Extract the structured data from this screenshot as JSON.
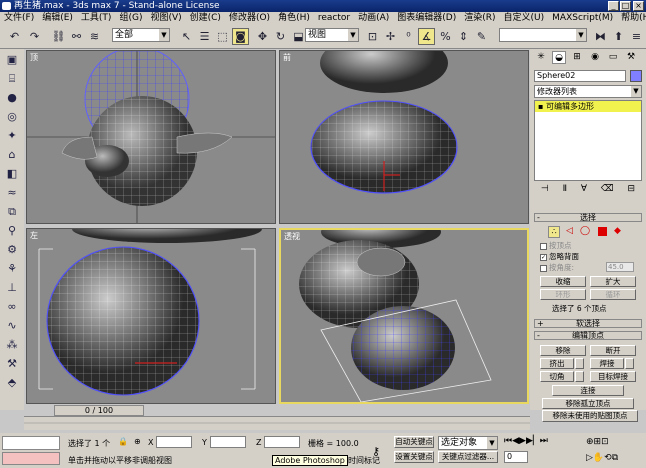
{
  "titlebar": {
    "title": "再生猪.max - 3ds max 7 - Stand-alone License",
    "min": "_",
    "max": "□",
    "close": "×"
  },
  "menu": [
    "文件(F)",
    "编辑(E)",
    "工具(T)",
    "组(G)",
    "视图(V)",
    "创建(C)",
    "修改器(O)",
    "角色(H)",
    "reactor",
    "动画(A)",
    "图表编辑器(D)",
    "渲染(R)",
    "自定义(U)",
    "MAXScript(M)",
    "帮助(H)"
  ],
  "toolbar": {
    "filter_select": "全部",
    "refcoord_select": "视图"
  },
  "viewports": {
    "top": "顶",
    "front": "前",
    "left": "左",
    "persp": "透视"
  },
  "cmd": {
    "object_name": "Sphere02",
    "modifier_list": "修改器列表",
    "stack_item": "可编辑多边形",
    "selection": {
      "header": "选择",
      "by_vertex": "按顶点",
      "ignore_backfacing": "忽略背面",
      "by_angle": "按角度:",
      "angle_value": "45.0",
      "shrink": "收缩",
      "grow": "扩大",
      "ring": "环形",
      "loop": "循环",
      "selected_text": "选择了 6 个顶点"
    },
    "soft_selection": "软选择",
    "edit_vertices": {
      "header": "编辑顶点",
      "remove": "移除",
      "break": "断开",
      "extrude": "挤出",
      "weld": "焊接",
      "chamfer": "切角",
      "target_weld": "目标焊接",
      "connect": "连接",
      "remove_isolated": "移除孤立顶点",
      "remove_unused": "移除未使用的贴图顶点"
    }
  },
  "timeline": {
    "frame": "0 / 100"
  },
  "status": {
    "selected": "选择了 1 个",
    "x_label": "X",
    "y_label": "Y",
    "z_label": "Z",
    "grid": "栅格 = 100.0",
    "autokey": "自动关键点",
    "set_key": "设置关键点",
    "selected_object": "选定对象",
    "key_filters": "关键点过滤器...",
    "prompt": "单击并拖动以平移非调船视图",
    "add_time_tag": "添加时间标记",
    "frame_value": "0",
    "tooltip": "Adobe Photoshop"
  }
}
